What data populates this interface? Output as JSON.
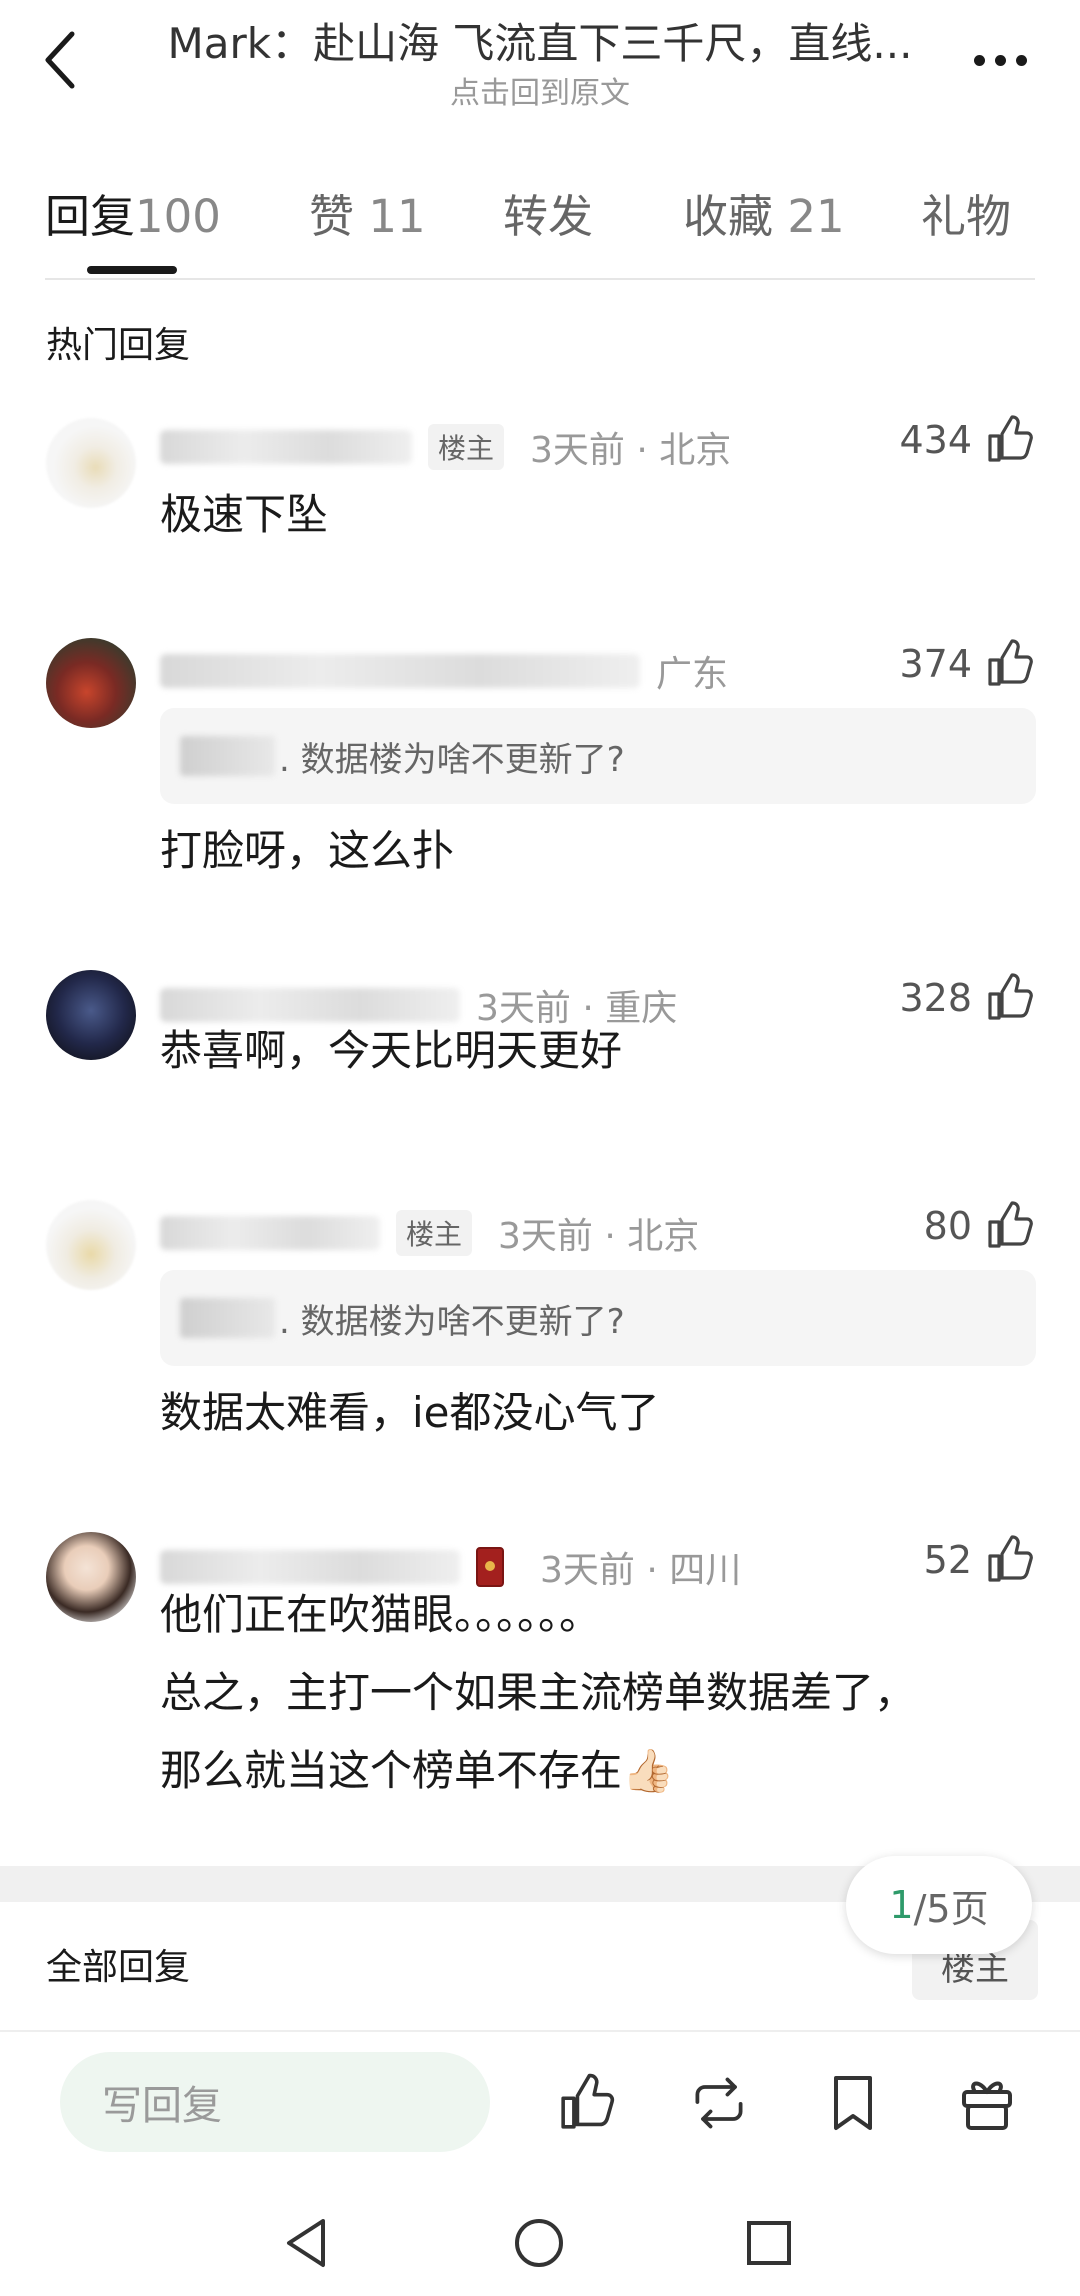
{
  "header": {
    "title": "Mark：赴山海  飞流直下三千尺，直线...",
    "subtitle": "点击回到原文"
  },
  "tabs": [
    {
      "label": "回复",
      "count": "100"
    },
    {
      "label": "赞",
      "count": "11"
    },
    {
      "label": "转发",
      "count": ""
    },
    {
      "label": "收藏",
      "count": "21"
    },
    {
      "label": "礼物",
      "count": ""
    }
  ],
  "hot_section_title": "热门回复",
  "comments": [
    {
      "op_tag": "楼主",
      "time_location": "3天前 · 北京",
      "likes": "434",
      "text": "极速下坠"
    },
    {
      "time_location": "广东",
      "likes": "374",
      "quote": ". 数据楼为啥不更新了?",
      "text": "打脸呀，这么扑"
    },
    {
      "time_location": "3天前 · 重庆",
      "likes": "328",
      "text": "恭喜啊，今天比明天更好"
    },
    {
      "op_tag": "楼主",
      "time_location": "3天前 · 北京",
      "likes": "80",
      "quote": ". 数据楼为啥不更新了?",
      "text": "数据太难看，ie都没心气了"
    },
    {
      "time_location": "3天前 · 四川",
      "likes": "52",
      "text_lines": [
        "他们正在吹猫眼。。。。。。",
        "总之，主打一个如果主流榜单数据差了，",
        "那么就当这个榜单不存在👍🏻"
      ]
    }
  ],
  "pagination": {
    "current": "1",
    "total_label": "/5页"
  },
  "all_replies_title": "全部回复",
  "op_filter_label": "楼主",
  "bottom_bar": {
    "reply_placeholder": "写回复"
  },
  "colors": {
    "accent_green": "#2e9a6a",
    "input_bg": "#eef6f0"
  }
}
